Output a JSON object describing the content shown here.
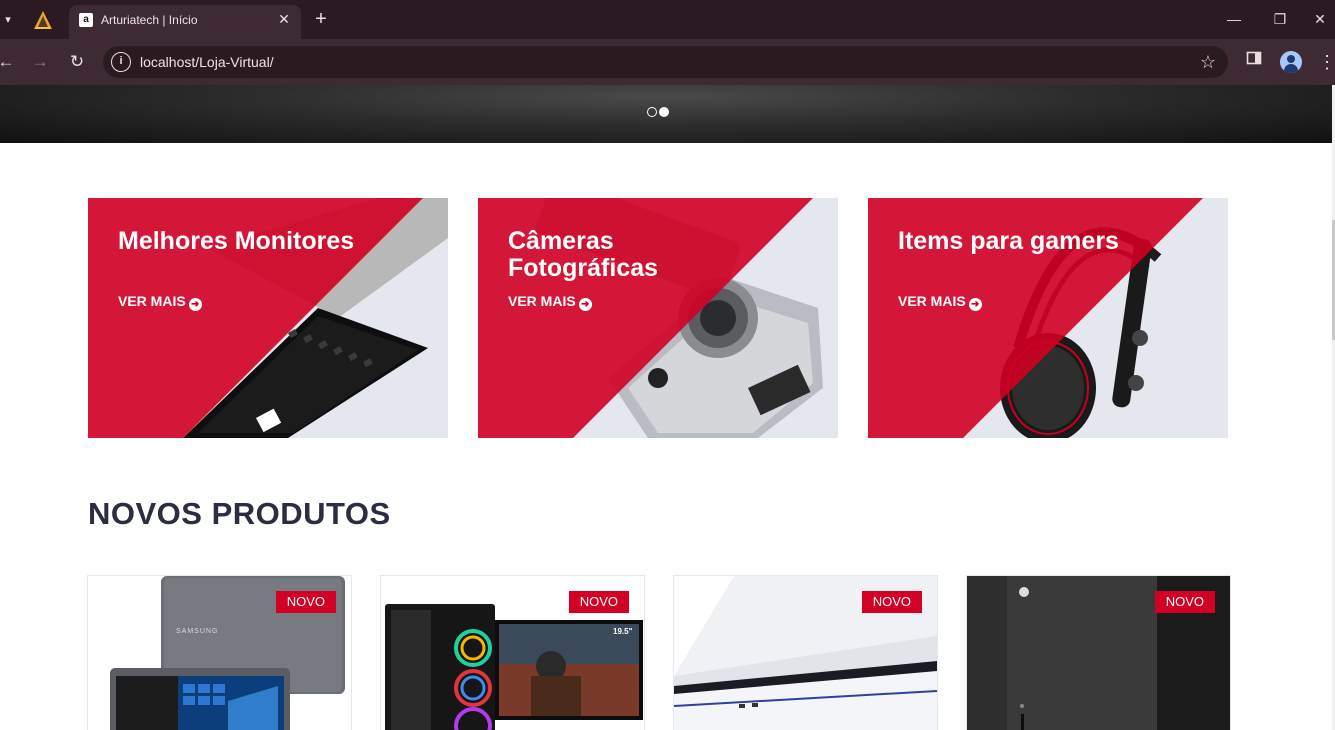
{
  "browser": {
    "tab_title": "Arturiatech | Início",
    "favicon_letter": "a",
    "url": "localhost/Loja-Virtual/"
  },
  "collections": [
    {
      "title": "Melhores Monitores",
      "cta": "VER MAIS"
    },
    {
      "title": "Câmeras Fotográficas",
      "cta": "VER MAIS"
    },
    {
      "title": "Items para gamers",
      "cta": "VER MAIS"
    }
  ],
  "section_title": "NOVOS PRODUTOS",
  "products": [
    {
      "badge": "NOVO",
      "image": "samsung-notebook",
      "brand_text": "SAMSUNG"
    },
    {
      "badge": "NOVO",
      "image": "gamer-pc-with-monitor",
      "monitor_size": "19.5\""
    },
    {
      "badge": "NOVO",
      "image": "playstation-5"
    },
    {
      "badge": "NOVO",
      "image": "xbox-series-x"
    }
  ],
  "colors": {
    "accent": "#d10024",
    "heading": "#2b2d42",
    "chrome": "#3e2a33"
  },
  "carousel": {
    "slides": 2,
    "active_slide": 2
  }
}
